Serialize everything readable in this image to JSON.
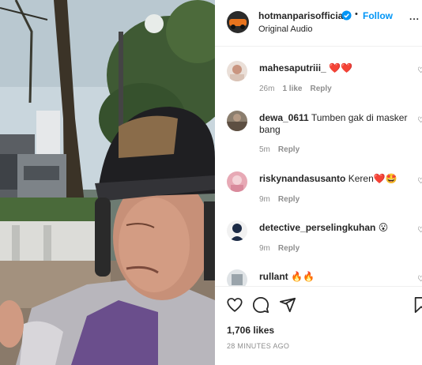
{
  "post": {
    "username": "hotmanparisofficial",
    "dot": "•",
    "follow_label": "Follow",
    "audio": "Original Audio",
    "more": "..."
  },
  "comments": [
    {
      "username": "mahesaputriii_",
      "text": "❤️❤️",
      "time": "26m",
      "likes": "1 like",
      "reply": "Reply"
    },
    {
      "username": "dewa_0611",
      "text": "Tumben gak di masker bang",
      "time": "5m",
      "reply": "Reply"
    },
    {
      "username": "riskynandasusanto",
      "text": "Keren❤️🤩",
      "time": "9m",
      "reply": "Reply"
    },
    {
      "username": "detective_perselingkuhan",
      "text": "😮",
      "time": "9m",
      "reply": "Reply"
    },
    {
      "username": "rullant",
      "text": "🔥🔥"
    }
  ],
  "footer": {
    "likes": "1,706 likes",
    "time_ago": "28 MINUTES AGO"
  },
  "colors": {
    "accent": "#0095f6",
    "muted": "#8e8e8e",
    "text": "#262626"
  },
  "icons": [
    "heart-icon",
    "comment-icon",
    "share-icon",
    "bookmark-icon",
    "verified-badge-icon",
    "more-options-icon"
  ]
}
